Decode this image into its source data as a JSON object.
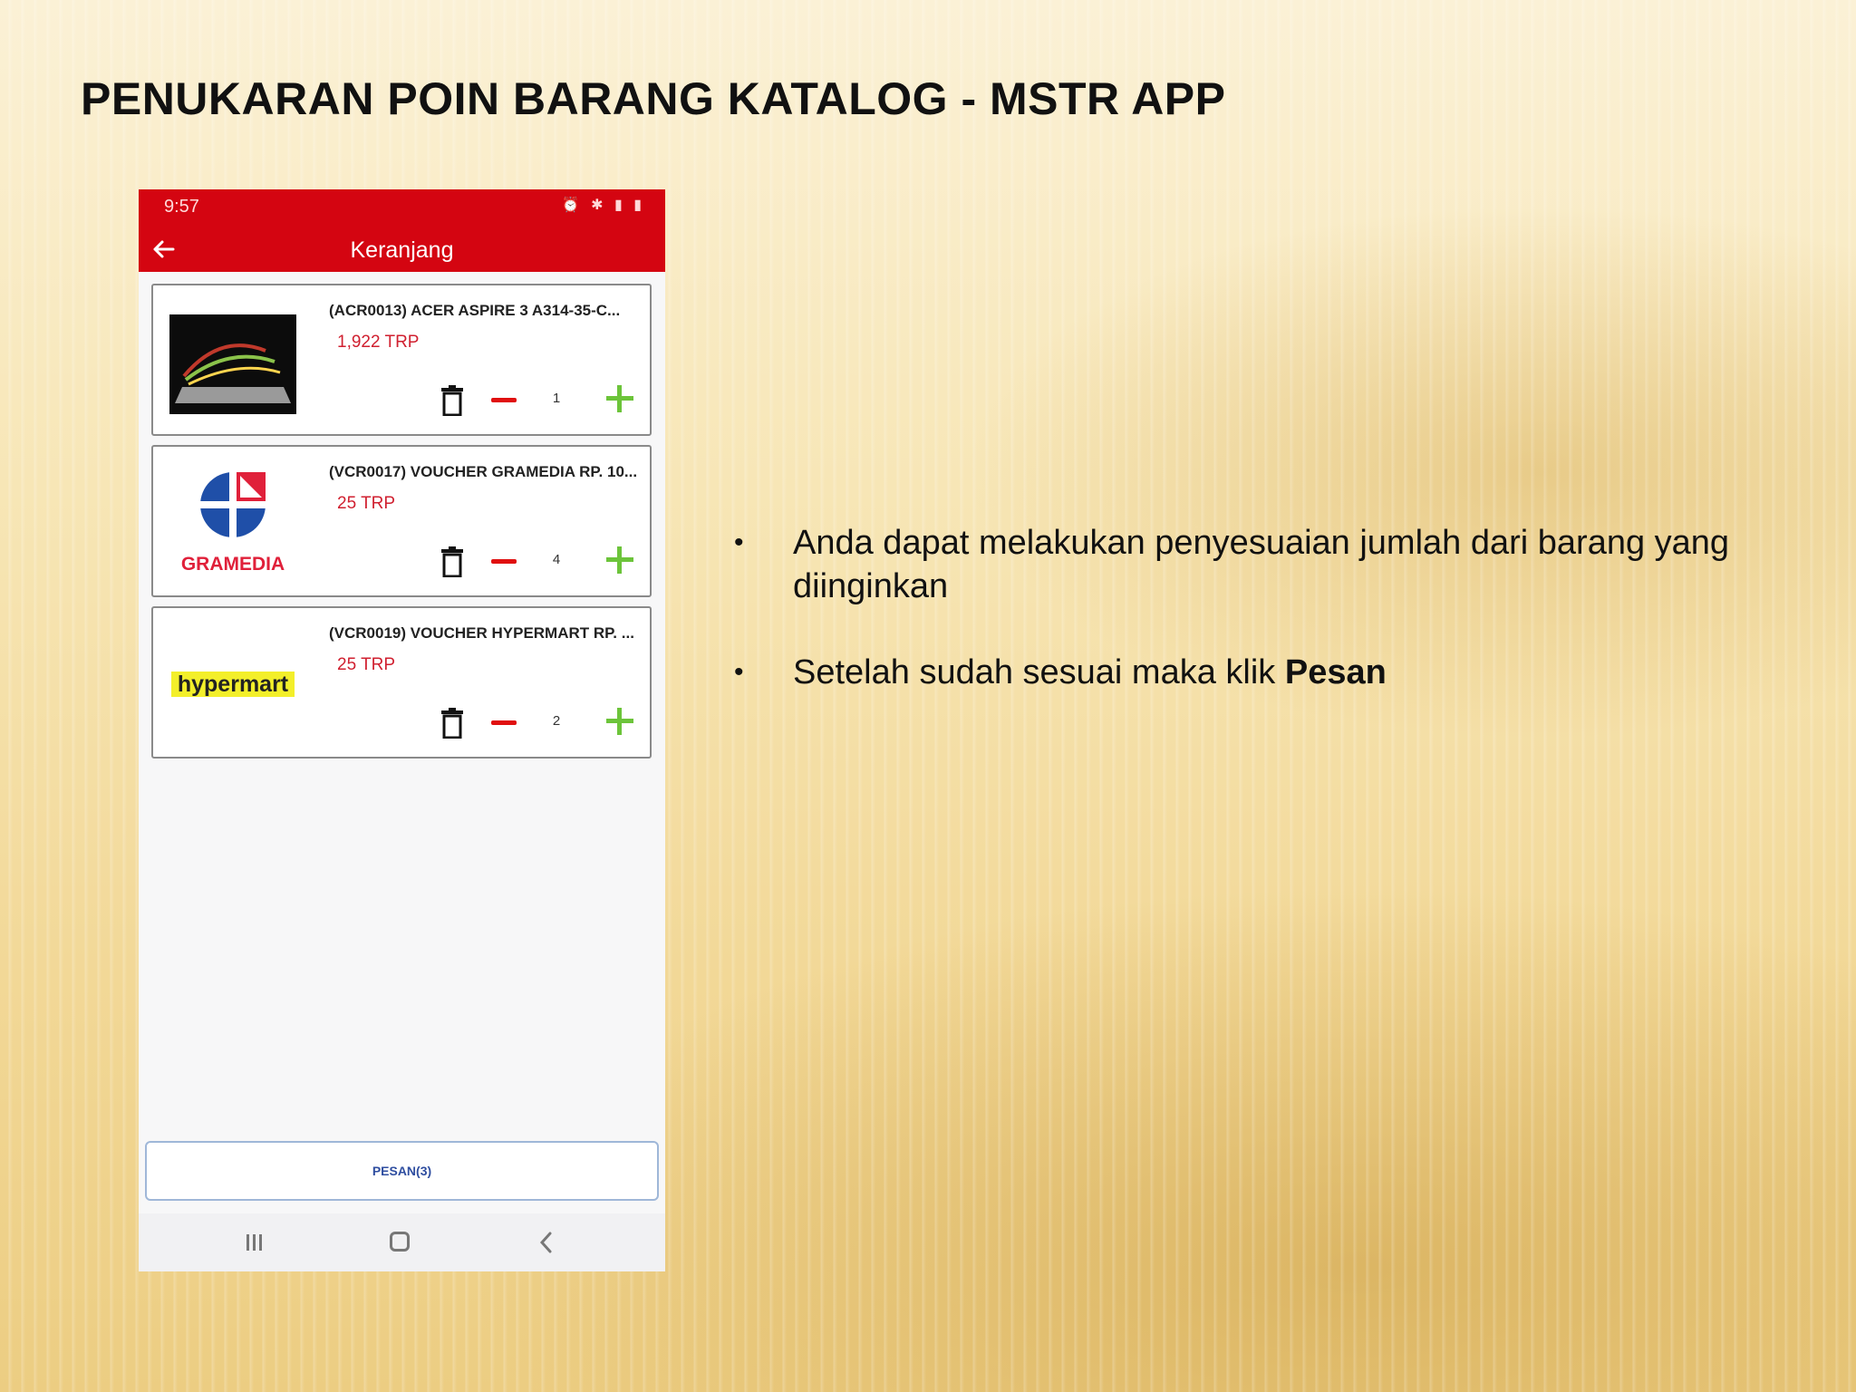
{
  "slide": {
    "title": "PENUKARAN POIN BARANG KATALOG - MSTR APP"
  },
  "phone": {
    "status_time": "9:57",
    "appbar_title": "Keranjang",
    "items": [
      {
        "name": "(ACR0013) ACER ASPIRE 3 A314-35-C...",
        "price": "1,922 TRP",
        "qty": "1",
        "thumb": "laptop"
      },
      {
        "name": "(VCR0017) VOUCHER GRAMEDIA RP. 10...",
        "price": "25 TRP",
        "qty": "4",
        "thumb": "gramedia-logo",
        "logo_text": "GRAMEDIA"
      },
      {
        "name": "(VCR0019) VOUCHER HYPERMART RP. ...",
        "price": "25 TRP",
        "qty": "2",
        "thumb": "hypermart-logo",
        "logo_text": "hypermart"
      }
    ],
    "order_button": "PESAN(3)",
    "colors": {
      "appbar": "#d40511",
      "minus": "#e01010",
      "plus": "#6cc43a",
      "price": "#d02030"
    }
  },
  "bullets": {
    "item1": "Anda dapat melakukan penyesuaian jumlah dari barang yang diinginkan",
    "item2_prefix": "Setelah sudah sesuai maka klik ",
    "item2_bold": "Pesan"
  }
}
